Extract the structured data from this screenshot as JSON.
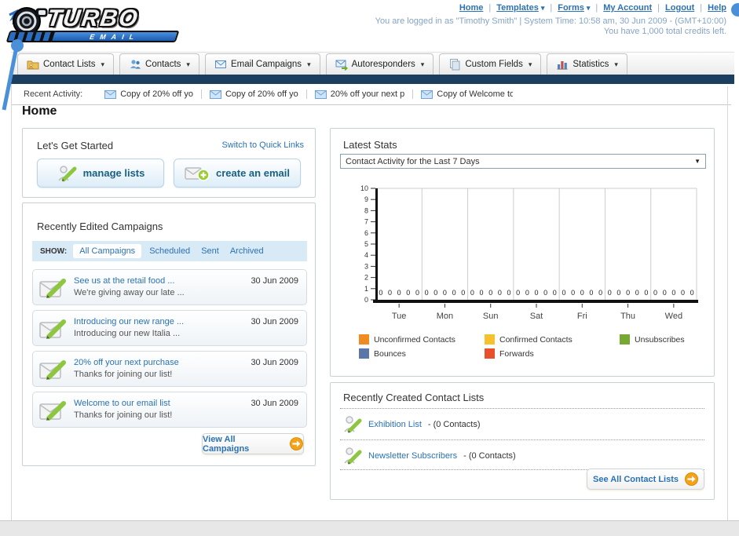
{
  "header": {
    "logo_title": "TURBO",
    "logo_subtitle": "EMAIL",
    "nav_links": [
      {
        "label": "Home",
        "dropdown": false
      },
      {
        "label": "Templates",
        "dropdown": true
      },
      {
        "label": "Forms",
        "dropdown": true
      },
      {
        "label": "My Account",
        "dropdown": false
      },
      {
        "label": "Logout",
        "dropdown": false
      },
      {
        "label": "Help",
        "dropdown": false
      }
    ],
    "login_line1": "You are logged in as \"Timothy Smith\" | System Time: 10:58 am, 30 Jun 2009 - (GMT+10:00)",
    "login_line2": "You have 1,000 total credits left."
  },
  "tabs": [
    {
      "label": "Contact Lists",
      "icon": "folder-icon"
    },
    {
      "label": "Contacts",
      "icon": "contacts-icon"
    },
    {
      "label": "Email Campaigns",
      "icon": "envelope-icon"
    },
    {
      "label": "Autoresponders",
      "icon": "envelope-arrow-icon"
    },
    {
      "label": "Custom Fields",
      "icon": "pages-icon"
    },
    {
      "label": "Statistics",
      "icon": "bar-chart-icon"
    }
  ],
  "recent_activity": {
    "label": "Recent Activity:",
    "items": [
      "Copy of 20% off yo",
      "Copy of 20% off yo",
      "20% off your next p",
      "Copy of Welcome to"
    ]
  },
  "page_title": "Home",
  "get_started": {
    "title": "Let's Get Started",
    "switch_link": "Switch to Quick Links",
    "buttons": [
      {
        "label": "manage lists",
        "icon": "person-pencil-icon"
      },
      {
        "label": "create an email",
        "icon": "envelope-plus-icon"
      }
    ]
  },
  "campaigns": {
    "title": "Recently Edited Campaigns",
    "show_label": "SHOW:",
    "filters": [
      {
        "label": "All Campaigns",
        "active": true
      },
      {
        "label": "Scheduled",
        "active": false
      },
      {
        "label": "Sent",
        "active": false
      },
      {
        "label": "Archived",
        "active": false
      }
    ],
    "items": [
      {
        "title": "See us at the retail food ...",
        "subtitle": "We're giving away our late ...",
        "date": "30 Jun 2009"
      },
      {
        "title": "Introducing our new range ...",
        "subtitle": "Introducing our new Italia ...",
        "date": "30 Jun 2009"
      },
      {
        "title": "20% off your next purchase",
        "subtitle": "Thanks for joining our list!",
        "date": "30 Jun 2009"
      },
      {
        "title": "Welcome to our email list",
        "subtitle": "Thanks for joining our list!",
        "date": "30 Jun 2009"
      }
    ],
    "view_all_label": "View All Campaigns"
  },
  "latest_stats": {
    "title": "Latest Stats",
    "dropdown_value": "Contact Activity for the Last 7 Days",
    "chart_data": {
      "type": "bar",
      "categories": [
        "Tue",
        "Mon",
        "Sun",
        "Sat",
        "Fri",
        "Thu",
        "Wed"
      ],
      "series": [
        {
          "name": "Unconfirmed Contacts",
          "color": "#F08B22",
          "values": [
            0,
            0,
            0,
            0,
            0,
            0,
            0
          ]
        },
        {
          "name": "Confirmed Contacts",
          "color": "#F5C12E",
          "values": [
            0,
            0,
            0,
            0,
            0,
            0,
            0
          ]
        },
        {
          "name": "Unsubscribes",
          "color": "#76A832",
          "values": [
            0,
            0,
            0,
            0,
            0,
            0,
            0
          ]
        },
        {
          "name": "Bounces",
          "color": "#5B76A8",
          "values": [
            0,
            0,
            0,
            0,
            0,
            0,
            0
          ]
        },
        {
          "name": "Forwards",
          "color": "#E8502B",
          "values": [
            0,
            0,
            0,
            0,
            0,
            0,
            0
          ]
        }
      ],
      "ylim": [
        0,
        10
      ],
      "ytick_step": 1,
      "grid": "vertical",
      "legend_position": "bottom"
    }
  },
  "contact_lists": {
    "title": "Recently Created Contact Lists",
    "items": [
      {
        "name": "Exhibition List",
        "detail": "- (0 Contacts)"
      },
      {
        "name": "Newsletter Subscribers",
        "detail": "- (0 Contacts)"
      }
    ],
    "see_all_label": "See All Contact Lists"
  },
  "icons": {
    "folder-icon": "yellow folder",
    "contacts-icon": "two people",
    "envelope-icon": "envelope",
    "envelope-arrow-icon": "envelope with green arrow",
    "pages-icon": "stacked pages",
    "bar-chart-icon": "bar chart",
    "person-pencil-icon": "person with green pencil",
    "envelope-pencil-icon": "envelope with green pencil",
    "envelope-plus-icon": "envelope with green plus",
    "orange-arrow-icon": "orange circle right arrow",
    "annotation-pin": "blue callout pin"
  },
  "colors": {
    "navy_bar": "#1c3e5f",
    "link_blue": "#2a72b5",
    "login_text": "#85a3c6",
    "button_text": "#1a6080",
    "show_bar_bg": "#d9eaf7",
    "pin_blue": "#4a90d9"
  }
}
